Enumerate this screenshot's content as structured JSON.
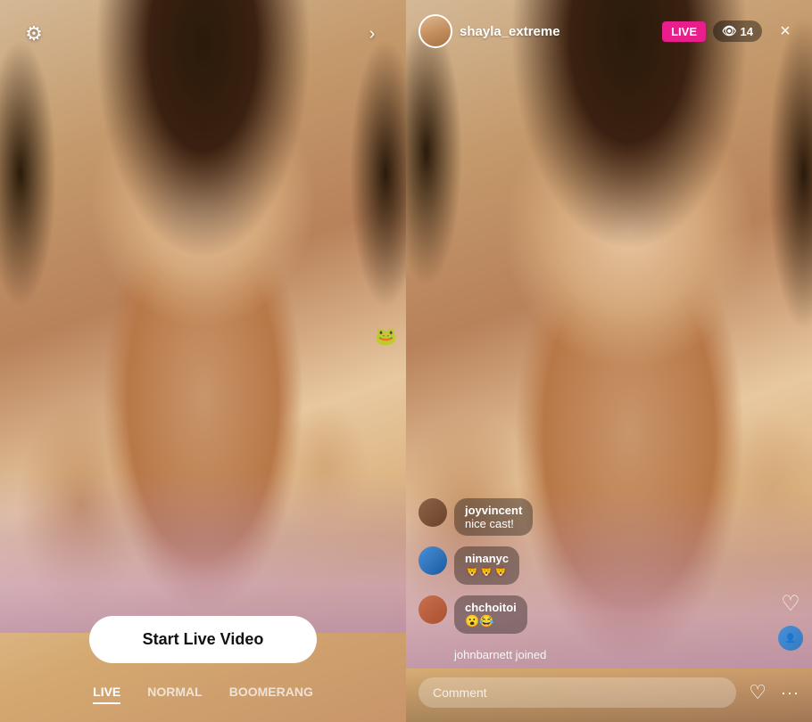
{
  "left_panel": {
    "settings_icon": "⚙",
    "chevron_icon": "›",
    "start_live_button": "Start Live Video",
    "modes": [
      {
        "label": "LIVE",
        "active": true
      },
      {
        "label": "NORMAL",
        "active": false
      },
      {
        "label": "BOOMERANG",
        "active": false
      }
    ]
  },
  "right_panel": {
    "username": "shayla_extreme",
    "live_badge": "LIVE",
    "viewer_count": "14",
    "viewer_icon": "👁",
    "close_icon": "×",
    "comments": [
      {
        "username": "joyvincent",
        "text": "nice cast!",
        "avatar_class": "av-joy"
      },
      {
        "username": "ninanyc",
        "text": "🦁🦁🦁",
        "avatar_class": "av-nina"
      },
      {
        "username": "chchoitoi",
        "text": "😮😂",
        "avatar_class": "av-chch"
      }
    ],
    "joined_notice": "johnbarnett joined",
    "comment_placeholder": "Comment",
    "heart_icon": "♡",
    "more_icon": "···"
  }
}
